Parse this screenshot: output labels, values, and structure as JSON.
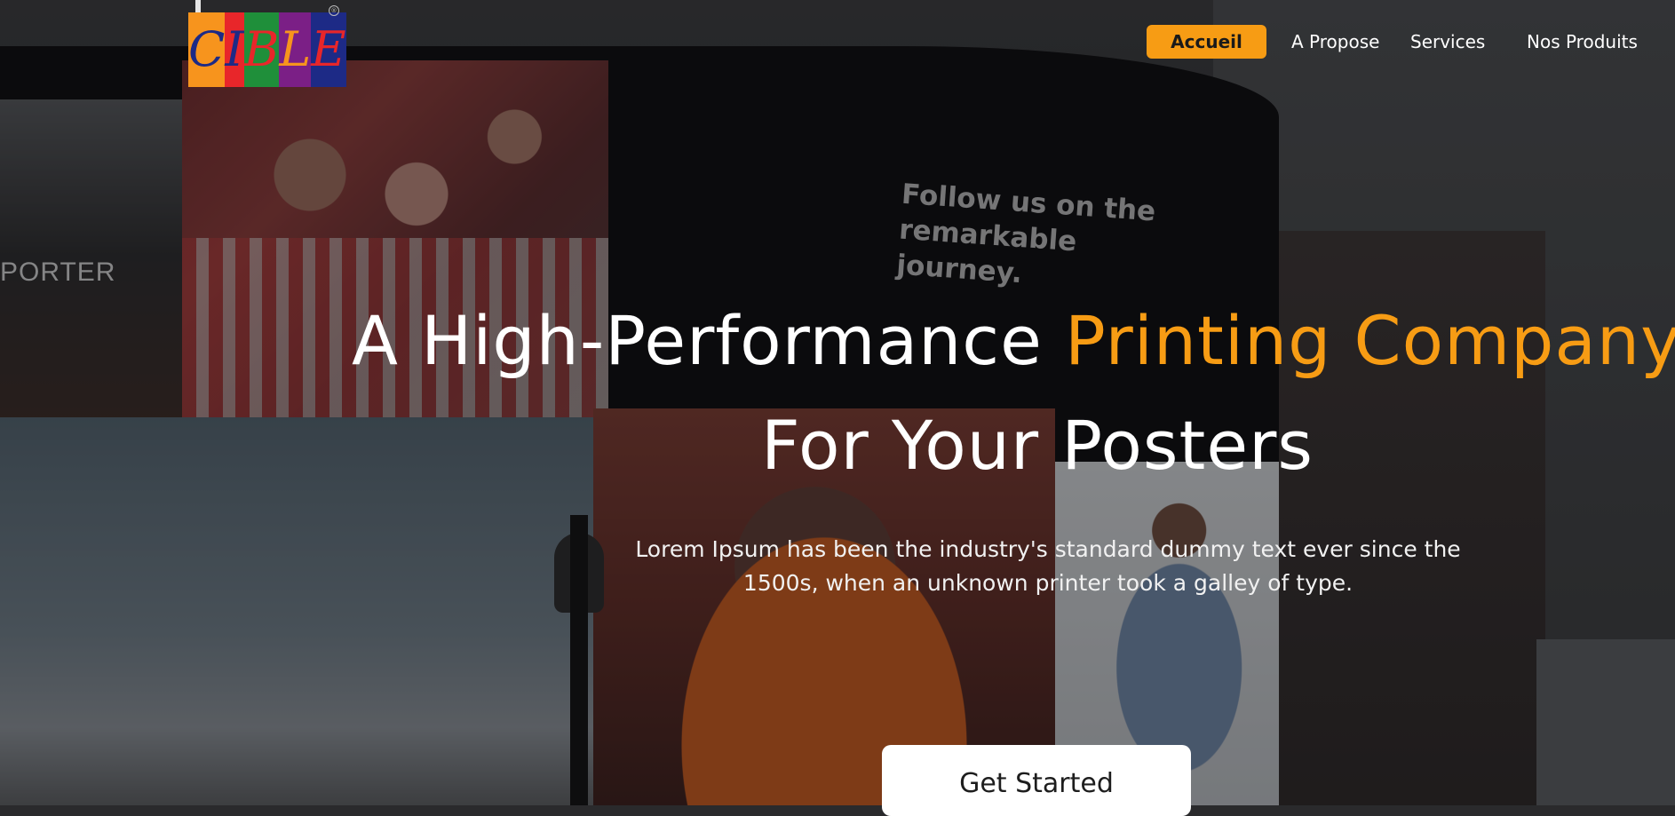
{
  "logo": {
    "letters": [
      {
        "char": "C",
        "bg": "#f7941d",
        "fg": "#1d2a86"
      },
      {
        "char": "I",
        "bg": "#e8262a",
        "fg": "#1d2a86"
      },
      {
        "char": "B",
        "bg": "#1f8f3a",
        "fg": "#e8262a"
      },
      {
        "char": "L",
        "bg": "#7b1f86",
        "fg": "#f7941d"
      },
      {
        "char": "E",
        "bg": "#1d2a86",
        "fg": "#e8262a"
      }
    ],
    "registered_mark": "®"
  },
  "nav": {
    "items": [
      {
        "label": "Accueil",
        "active": true
      },
      {
        "label": "A Propose",
        "active": false
      },
      {
        "label": "Services",
        "active": false
      },
      {
        "label": "Nos Produits",
        "active": false
      }
    ]
  },
  "hero": {
    "title_part1": "A High-Performance ",
    "title_accent": "Printing Company",
    "title_line2": "For Your Posters",
    "description": "Lorem Ipsum has been the industry's standard dummy text ever since the 1500s, when an unknown printer took a galley of type.",
    "cta_label": "Get Started"
  },
  "background": {
    "billboard_text": "Follow us on the remarkable journey.",
    "side_sign": "PORTER"
  },
  "colors": {
    "accent": "#f79c14",
    "text": "#ffffff",
    "cta_bg": "#ffffff"
  }
}
